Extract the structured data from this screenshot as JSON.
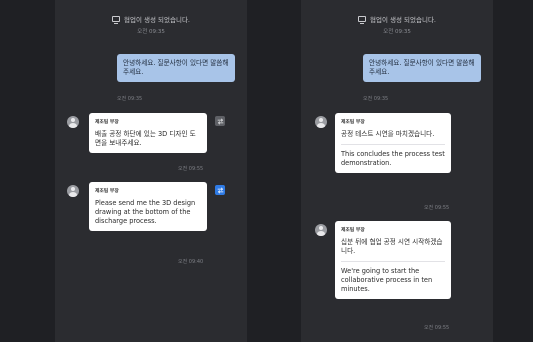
{
  "left": {
    "system_notice": {
      "text": "협업이 생성 되었습니다.",
      "time": "오전 09:35"
    },
    "my_message": {
      "text": "안녕하세요. 질문사항이 있다면 말씀해주세요.",
      "time": "오전 09:35"
    },
    "messages": [
      {
        "sender": "제조팀 부장",
        "text": "배출 공정 하단에 있는 3D 디자인 도면을 보내주세요.",
        "time": "오전 09:55"
      },
      {
        "sender": "제조팀 부장",
        "text": "Please send me the 3D design drawing at the bottom of the discharge process.",
        "time": "오전 09:40"
      }
    ]
  },
  "right": {
    "system_notice": {
      "text": "협업이 생성 되었습니다.",
      "time": "오전 09:35"
    },
    "my_message": {
      "text": "안녕하세요. 질문사항이 있다면 말씀해주세요.",
      "time": "오전 09:35"
    },
    "messages": [
      {
        "sender": "제조팀 부장",
        "text": "공정 테스트 시연을 마치겠습니다.",
        "translation": "This concludes the process test demonstration.",
        "time": "오전 09:55"
      },
      {
        "sender": "제조팀 부장",
        "text": "십분 뒤에 협업 공정 시연 시작하겠습니다.",
        "translation": "We're going to start the collaborative process in ten minutes.",
        "time": "오전 09:55"
      }
    ]
  },
  "colors": {
    "background": "#1f2024",
    "panel": "#2b2c30",
    "my_bubble": "#a8c4e8",
    "their_bubble": "#ffffff",
    "translate_active": "#2f7be5"
  }
}
